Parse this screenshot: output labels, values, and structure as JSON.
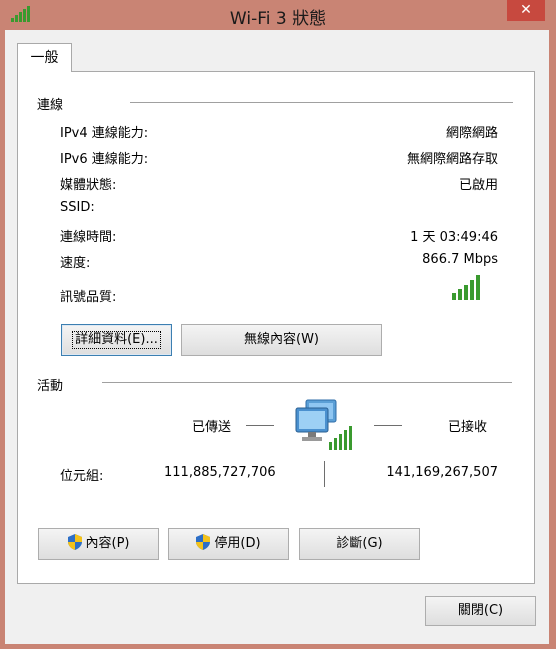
{
  "window": {
    "title": "Wi-Fi 3 狀態",
    "close_label": "✕"
  },
  "tab": {
    "label": "一般"
  },
  "connection": {
    "section_title": "連線",
    "rows": [
      {
        "label": "IPv4 連線能力:",
        "value": "網際網路"
      },
      {
        "label": "IPv6 連線能力:",
        "value": "無網際網路存取"
      },
      {
        "label": "媒體狀態:",
        "value": "已啟用"
      },
      {
        "label": "SSID:",
        "value": ""
      },
      {
        "label": "連線時間:",
        "value": "1 天 03:49:46"
      },
      {
        "label": "速度:",
        "value": "866.7 Mbps"
      }
    ],
    "signal_label": "訊號品質:",
    "signal_bars": 5,
    "signal_bars_total": 5,
    "signal_color": "#3a9a2f"
  },
  "buttons": {
    "details": "詳細資料(E)...",
    "wireless": "無線內容(W)",
    "properties": "內容(P)",
    "disable": "停用(D)",
    "diagnose": "診斷(G)",
    "close": "關閉(C)"
  },
  "activity": {
    "section_title": "活動",
    "sent_label": "已傳送",
    "received_label": "已接收",
    "bytes_label": "位元組:",
    "bytes_sent": "111,885,727,706",
    "bytes_received": "141,169,267,507"
  },
  "colors": {
    "titlebar": "#c98474",
    "close": "#c7493f",
    "dialog": "#f0f0f0"
  }
}
